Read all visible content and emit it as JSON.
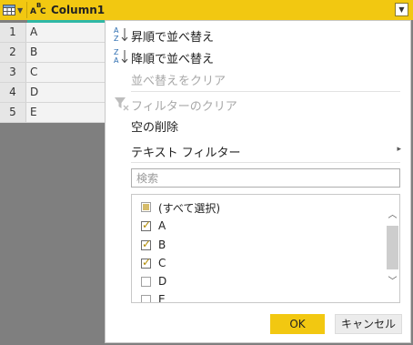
{
  "header": {
    "column_type_label": {
      "a": "A",
      "b": "B",
      "c": "C"
    },
    "column_name": "Column1",
    "table_icon": "table-icon",
    "menu_icon": "chevron-down-icon"
  },
  "rows": [
    {
      "num": "1",
      "value": "A"
    },
    {
      "num": "2",
      "value": "B"
    },
    {
      "num": "3",
      "value": "C"
    },
    {
      "num": "4",
      "value": "D"
    },
    {
      "num": "5",
      "value": "E"
    }
  ],
  "menu": {
    "sort_asc": "昇順で並べ替え",
    "sort_desc": "降順で並べ替え",
    "clear_sort": "並べ替えをクリア",
    "clear_filter": "フィルターのクリア",
    "remove_empty": "空の削除",
    "text_filter": "テキスト フィルター",
    "search_placeholder": "検索",
    "items": [
      {
        "label": "(すべて選択)",
        "state": "partial"
      },
      {
        "label": "A",
        "state": "checked"
      },
      {
        "label": "B",
        "state": "checked"
      },
      {
        "label": "C",
        "state": "checked"
      },
      {
        "label": "D",
        "state": "unchecked"
      },
      {
        "label": "E",
        "state": "unchecked"
      }
    ],
    "ok": "OK",
    "cancel": "キャンセル"
  },
  "colors": {
    "accent": "#f2c811",
    "teal": "#2fb8a6"
  }
}
